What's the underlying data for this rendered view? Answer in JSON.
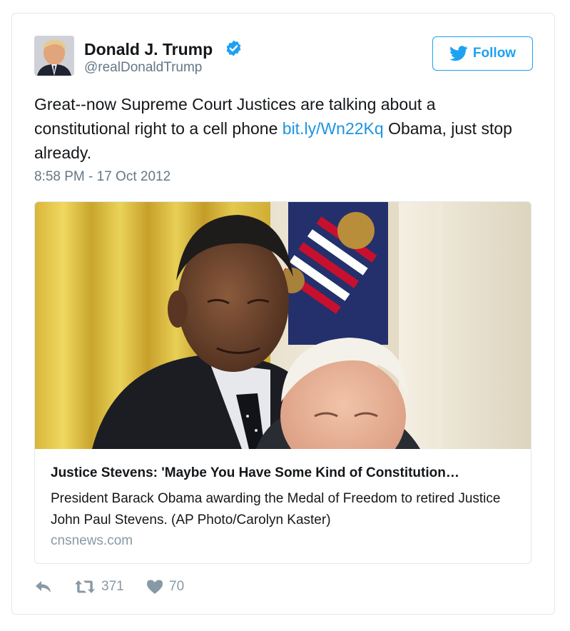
{
  "author": {
    "name": "Donald J. Trump",
    "handle": "@realDonaldTrump",
    "verified": true
  },
  "follow_button": {
    "label": "Follow",
    "icon": "twitter-bird-icon"
  },
  "tweet": {
    "text_before_link": "Great--now Supreme Court Justices are talking about a constitutional right to a cell phone ",
    "link_text": "bit.ly/Wn22Kq",
    "text_after_link": " Obama, just stop already.",
    "timestamp": "8:58 PM - 17 Oct 2012"
  },
  "card": {
    "title": "Justice Stevens: 'Maybe You Have Some Kind of Constitution…",
    "description": "President Barack Obama awarding the Medal of Freedom to retired Justice John Paul Stevens. (AP Photo/Carolyn Kaster)",
    "domain": "cnsnews.com"
  },
  "actions": {
    "reply_icon": "reply-icon",
    "retweet_icon": "retweet-icon",
    "retweet_count": "371",
    "like_icon": "heart-icon",
    "like_count": "70"
  },
  "colors": {
    "accent": "#1da1f2",
    "link": "#1b95e0",
    "muted": "#657786",
    "action_gray": "#8899a6",
    "border": "#e1e8ed"
  }
}
